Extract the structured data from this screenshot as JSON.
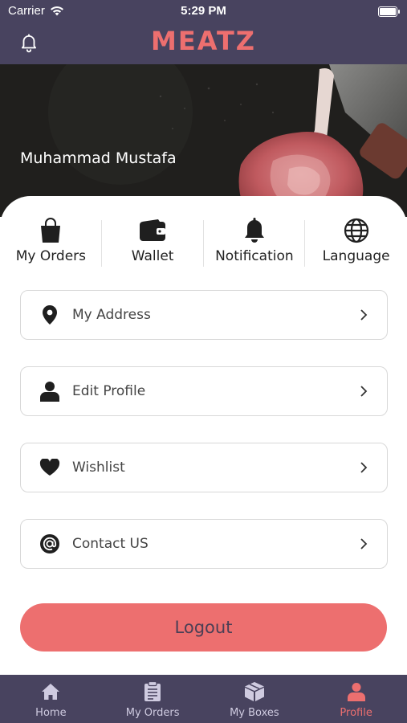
{
  "status_bar": {
    "carrier": "Carrier",
    "time": "5:29 PM"
  },
  "app_bar": {
    "logo": "MEATZ",
    "notification_icon": "bell-icon"
  },
  "profile": {
    "user_name": "Muhammad Mustafa"
  },
  "quick_actions": [
    {
      "label": "My Orders",
      "icon": "shopping-bag-icon"
    },
    {
      "label": "Wallet",
      "icon": "wallet-icon"
    },
    {
      "label": "Notification",
      "icon": "bell-icon"
    },
    {
      "label": "Language",
      "icon": "globe-icon"
    }
  ],
  "menu_rows": [
    {
      "label": "My Address",
      "icon": "location-pin-icon"
    },
    {
      "label": "Edit Profile",
      "icon": "person-icon"
    },
    {
      "label": "Wishlist",
      "icon": "heart-icon"
    },
    {
      "label": "Contact US",
      "icon": "at-sign-icon"
    }
  ],
  "logout_label": "Logout",
  "tabs": [
    {
      "label": "Home",
      "icon": "home-icon",
      "active": false
    },
    {
      "label": "My Orders",
      "icon": "clipboard-icon",
      "active": false
    },
    {
      "label": "My Boxes",
      "icon": "box-icon",
      "active": false
    },
    {
      "label": "Profile",
      "icon": "profile-icon",
      "active": true
    }
  ],
  "colors": {
    "primary_dark": "#48435f",
    "accent": "#ed6f6f",
    "tab_inactive": "#cfcbe0"
  }
}
